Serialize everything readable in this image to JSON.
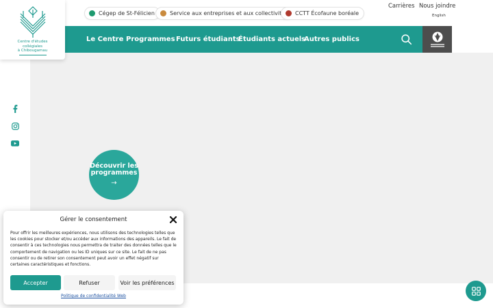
{
  "logo": {
    "line1": "Centre d'études",
    "line2": "collégiales",
    "line3": "à Chibougamau",
    "icon": "leaf-logo-icon"
  },
  "top_links": [
    {
      "label": "Cégep de St-Félicien",
      "dot_color": "#1e9a6f"
    },
    {
      "label": "Service aux entreprises et aux collectivités",
      "dot_color": "#c98a3e"
    },
    {
      "label": "CCTT Écofaune boréale",
      "dot_color": "#b03a2e"
    }
  ],
  "utility": {
    "careers": "Carrières",
    "contact": "Nous joindre",
    "language": "English"
  },
  "nav": {
    "items": [
      "Le Centre",
      "Programmes",
      "Futurs étudiants",
      "Étudiants actuels",
      "Autres publics"
    ],
    "search_icon": "search-icon",
    "emblem_icon": "emblem-icon"
  },
  "social": [
    "facebook-icon",
    "instagram-icon",
    "youtube-icon"
  ],
  "cta": {
    "line1": "Découvrir les",
    "line2": "programmes",
    "arrow": "→"
  },
  "consent": {
    "title": "Gérer le consentement",
    "body": "Pour offrir les meilleures expériences, nous utilisons des technologies telles que les cookies pour stocker et/ou accéder aux informations des appareils. Le fait de consentir à ces technologies nous permettra de traiter des données telles que le comportement de navigation ou les ID uniques sur ce site. Le fait de ne pas consentir ou de retirer son consentement peut avoir un effet négatif sur certaines caractéristiques et fonctions.",
    "accept": "Accepter",
    "refuse": "Refuser",
    "preferences": "Voir les préférences",
    "policy": "Politique de confidentialité Web"
  },
  "colors": {
    "brand": "#1e9a8f",
    "cta": "#2aa79b",
    "emblem_bg": "#4d4d4d",
    "background": "#f0f0f0"
  }
}
